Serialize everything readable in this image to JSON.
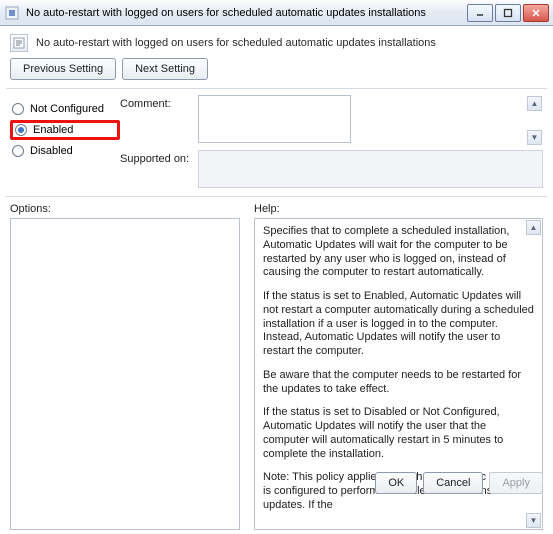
{
  "window": {
    "title": "No auto-restart with logged on users for scheduled automatic updates installations"
  },
  "header": {
    "policy_name": "No auto-restart with logged on users for scheduled automatic updates installations"
  },
  "nav": {
    "previous": "Previous Setting",
    "next": "Next Setting"
  },
  "state": {
    "not_configured": "Not Configured",
    "enabled": "Enabled",
    "disabled": "Disabled",
    "selected": "enabled"
  },
  "fields": {
    "comment_label": "Comment:",
    "comment_value": "",
    "supported_label": "Supported on:",
    "supported_value": ""
  },
  "panes": {
    "options_label": "Options:",
    "help_label": "Help:"
  },
  "help": {
    "p1": "Specifies that to complete a scheduled installation, Automatic Updates will wait for the computer to be restarted by any user who is logged on, instead of causing the computer to restart automatically.",
    "p2": "If the status is set to Enabled, Automatic Updates will not restart a computer automatically during a scheduled installation if a user is logged in to the computer. Instead, Automatic Updates will notify the user to restart the computer.",
    "p3": "Be aware that the computer needs to be restarted for the updates to take effect.",
    "p4": "If the status is set to Disabled or Not Configured, Automatic Updates will notify the user that the computer will automatically restart in 5 minutes to complete the installation.",
    "p5": "Note: This policy applies only when Automatic Updates is configured to perform scheduled installations of updates. If the"
  },
  "footer": {
    "ok": "OK",
    "cancel": "Cancel",
    "apply": "Apply"
  }
}
